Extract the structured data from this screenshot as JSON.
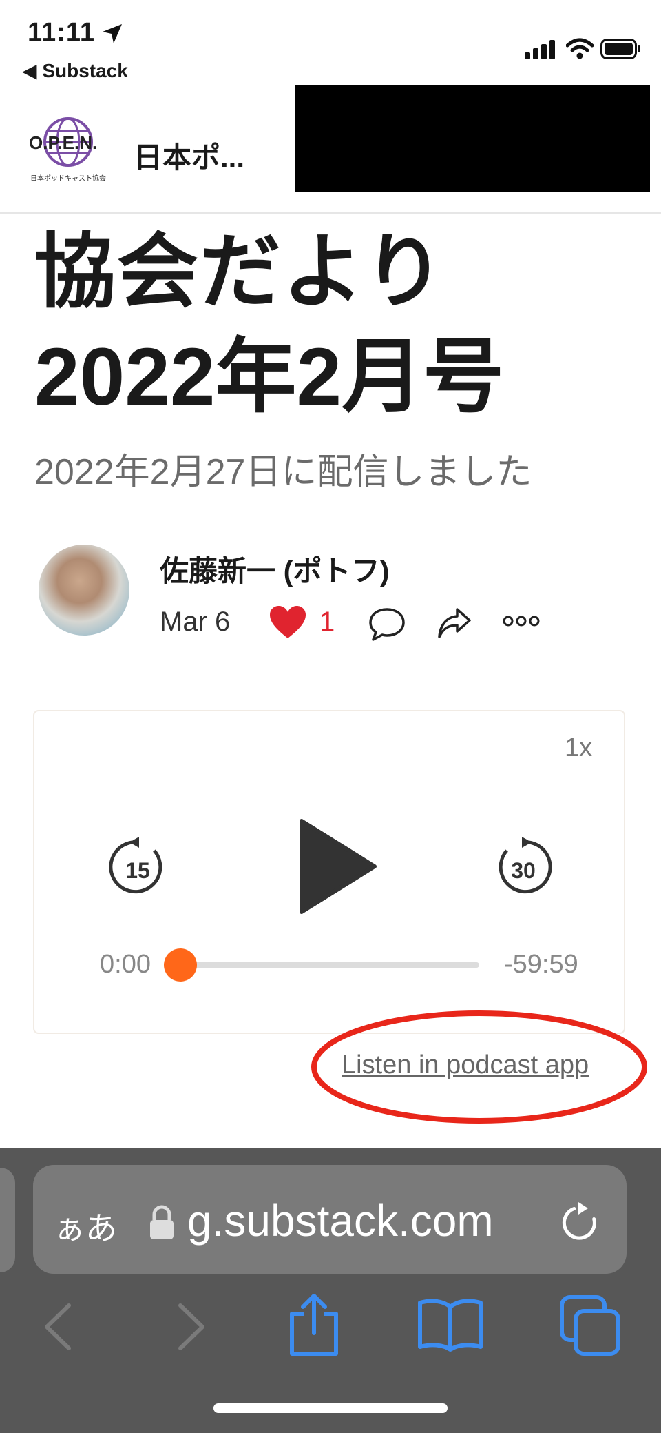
{
  "status_bar": {
    "time": "11:11",
    "back_label": "◀ Substack"
  },
  "header": {
    "logo_text": "O.P.E.N.",
    "logo_subtext": "日本ポッドキャスト協会",
    "publication_name": "日本ポ..."
  },
  "article": {
    "title_line1": "協会だより",
    "title_line2": "2022年2月号",
    "subtitle": "2022年2月27日に配信しました",
    "author": "佐藤新一 (ポトフ)",
    "date": "Mar 6",
    "like_count": "1"
  },
  "player": {
    "speed": "1x",
    "rewind_seconds": "15",
    "forward_seconds": "30",
    "current_time": "0:00",
    "remaining_time": "-59:59",
    "progress": 0
  },
  "listen_link": "Listen in podcast app",
  "browser": {
    "aa_label": "ぁあ",
    "url": "g.substack.com"
  },
  "colors": {
    "accent": "#ff6719",
    "like": "#e0242f",
    "annotation": "#e8261a",
    "safari_blue": "#3c8cf0"
  }
}
